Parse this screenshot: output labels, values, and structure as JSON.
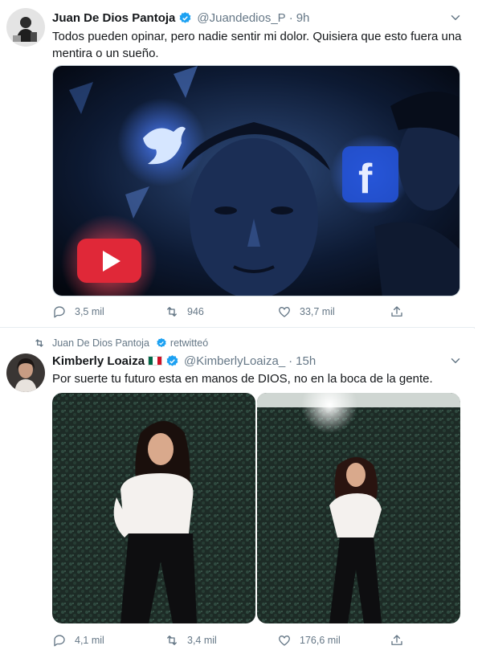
{
  "tweet1": {
    "display_name": "Juan De Dios Pantoja",
    "handle": "@Juandedios_P",
    "separator": "·",
    "time": "9h",
    "text": "Todos pueden opinar, pero nadie sentir mi dolor. Quisiera que esto fuera una mentira o un sueño.",
    "replies": "3,5 mil",
    "retweets": "946",
    "likes": "33,7 mil"
  },
  "retweet_banner": {
    "name": "Juan De Dios Pantoja",
    "suffix": "retwitteó"
  },
  "tweet2": {
    "display_name": "Kimberly Loaiza",
    "handle": "@KimberlyLoaiza_",
    "separator": "·",
    "time": "15h",
    "text": "Por suerte tu futuro esta en manos de DIOS, no en la boca de la gente.",
    "replies": "4,1 mil",
    "retweets": "3,4 mil",
    "likes": "176,6 mil"
  },
  "icons": {
    "verified": "verified-badge-icon",
    "caret": "chevron-down-icon",
    "reply": "reply-icon",
    "retweet": "retweet-icon",
    "like": "heart-icon",
    "share": "share-icon"
  },
  "colors": {
    "accent": "#1da1f2",
    "secondary_text": "#657786",
    "border": "#e6ecf0"
  }
}
